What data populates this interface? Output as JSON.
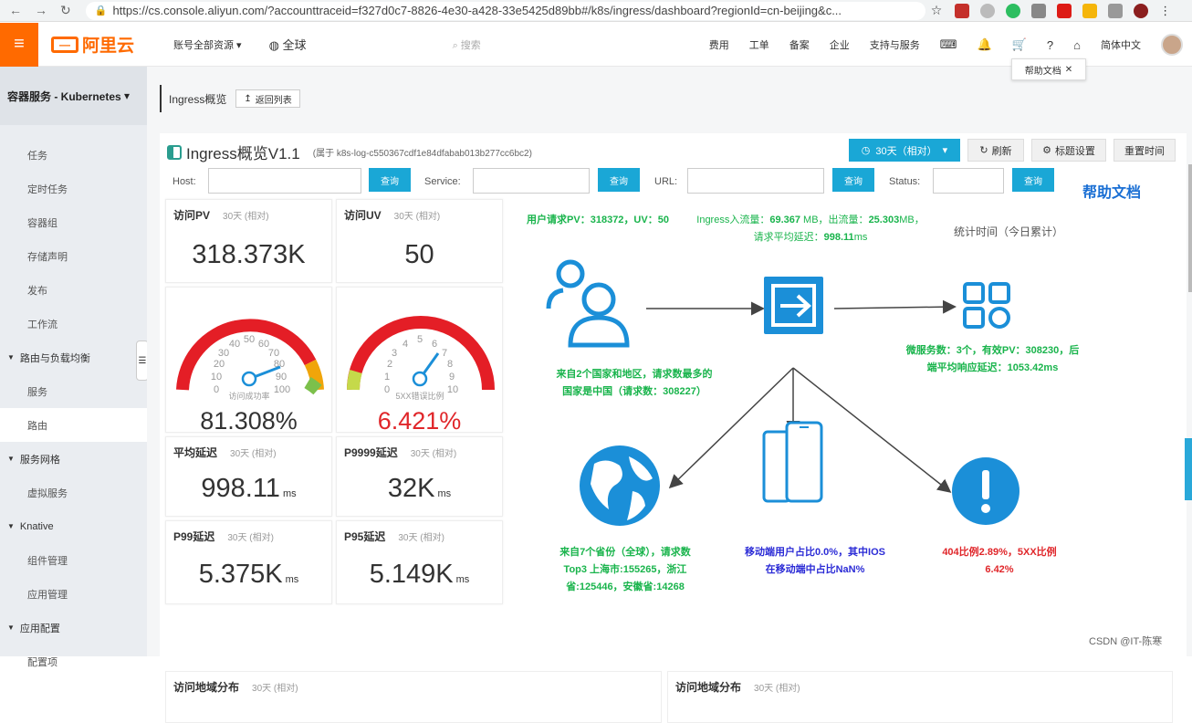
{
  "browser": {
    "url": "https://cs.console.aliyun.com/?accounttraceid=f327d0c7-8826-4e30-a428-33e5425d89bb#/k8s/ingress/dashboard?regionId=cn-beijing&c..."
  },
  "topbar": {
    "logo": "阿里云",
    "account": "账号全部资源",
    "region": "全球",
    "search_placeholder": "搜索",
    "links": [
      "费用",
      "工单",
      "备案",
      "企业",
      "支持与服务"
    ],
    "lang": "简体中文",
    "tooltip": "帮助文档"
  },
  "sidebar": {
    "title": "容器服务 - Kubernetes",
    "items": [
      {
        "label": "任务",
        "type": "item"
      },
      {
        "label": "定时任务",
        "type": "item"
      },
      {
        "label": "容器组",
        "type": "item"
      },
      {
        "label": "存储声明",
        "type": "item"
      },
      {
        "label": "发布",
        "type": "item"
      },
      {
        "label": "工作流",
        "type": "item"
      },
      {
        "label": "路由与负载均衡",
        "type": "group"
      },
      {
        "label": "服务",
        "type": "item"
      },
      {
        "label": "路由",
        "type": "item",
        "active": true
      },
      {
        "label": "服务网格",
        "type": "group"
      },
      {
        "label": "虚拟服务",
        "type": "item"
      },
      {
        "label": "Knative",
        "type": "group"
      },
      {
        "label": "组件管理",
        "type": "item"
      },
      {
        "label": "应用管理",
        "type": "item"
      },
      {
        "label": "应用配置",
        "type": "group"
      },
      {
        "label": "配置项",
        "type": "item"
      }
    ]
  },
  "page": {
    "title": "Ingress概览",
    "back": "返回列表"
  },
  "dashboard": {
    "title": "Ingress概览V1.1",
    "subtitle": "(属于 k8s-log-c550367cdf1e84dfabab013b277cc6bc2)",
    "time": "30天（相对）",
    "refresh": "刷新",
    "title_settings": "标题设置",
    "reset_time": "重置时间",
    "filters": {
      "host": "Host:",
      "service": "Service:",
      "url": "URL:",
      "status": "Status:",
      "query": "查询"
    },
    "help": "帮助文档",
    "range_note": "30天 (相对)",
    "cards": {
      "pv": {
        "title": "访问PV",
        "value": "318.373K"
      },
      "uv": {
        "title": "访问UV",
        "value": "50"
      },
      "success": {
        "label": "访问成功率",
        "value": "81.308%",
        "ticks": [
          "0",
          "10",
          "20",
          "30",
          "40",
          "50",
          "60",
          "70",
          "80",
          "90",
          "100"
        ]
      },
      "err5xx": {
        "label": "5XX错误比例",
        "value": "6.421%",
        "ticks": [
          "0",
          "1",
          "2",
          "3",
          "4",
          "5",
          "6",
          "7",
          "8",
          "9",
          "10"
        ]
      },
      "avg": {
        "title": "平均延迟",
        "value": "998.11",
        "unit": "ms"
      },
      "p9999": {
        "title": "P9999延迟",
        "value": "32K",
        "unit": "ms"
      },
      "p99": {
        "title": "P99延迟",
        "value": "5.375K",
        "unit": "ms"
      },
      "p95": {
        "title": "P95延迟",
        "value": "5.149K",
        "unit": "ms"
      }
    },
    "flow": {
      "user_req": "用户请求PV：",
      "pv": "318372",
      "uv_label": "，UV：",
      "uv": "50",
      "ingress_in": "Ingress入流量：",
      "in_val": "69.367",
      "mb_out": " MB，出流量：",
      "out_val": "25.303",
      "mb_lat": "MB，请求平均延迟：",
      "lat_val": "998.11",
      "ms": "ms",
      "stat_time": "统计时间（今日累计）",
      "countries_a": "来自2个国家和地区，请求数最多的",
      "countries_b": "国家是中国（请求数：",
      "countries_num": "308227",
      "close_paren": "）",
      "ms_a": "微服务数：",
      "ms_num": "3",
      "ms_b": "个，有效PV：",
      "ms_pv": "308230",
      "ms_c": "，后端平均响应延迟：",
      "ms_lat": "1053.42",
      "ms_unit": "ms",
      "prov_a": "来自7个省份（全球），请求数",
      "prov_b": "Top3 上海市:155265，浙江",
      "prov_c": "省:125446，安徽省:14268",
      "mob_a": "移动端用户占比",
      "mob_v": "0.0%",
      "mob_b": "，其中IOS",
      "mob_c": "在移动端中占比",
      "mob_v2": "NaN%",
      "err_a": "404比例",
      "err_v": "2.89%",
      "err_b": "，5XX比例",
      "err_v2": "6.42%"
    },
    "bottom": [
      {
        "title": "访问地域分布"
      },
      {
        "title": "访问地域分布"
      }
    ]
  },
  "watermark": "CSDN @IT-陈寒",
  "colors": {
    "accent": "#1aa7d6",
    "orange": "#ff6a00",
    "green": "#19b44c",
    "red": "#e0262a",
    "icon_blue": "#1b8fd8"
  }
}
